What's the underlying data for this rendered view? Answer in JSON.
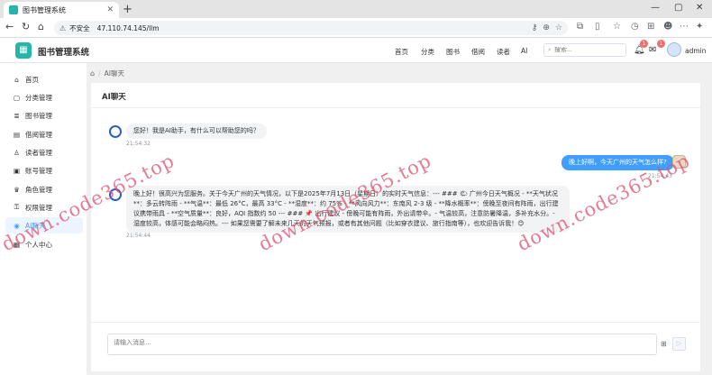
{
  "browser": {
    "tab_title": "图书管理系统",
    "tab_close": "✕",
    "new_tab": "+",
    "window_controls": [
      "—",
      "▢",
      "✕"
    ],
    "insecure_label": "不安全",
    "url": "47.110.74.145/llm"
  },
  "header": {
    "app_title": "图书管理系统",
    "nav": [
      "首页",
      "分类",
      "图书",
      "借阅",
      "读者",
      "AI"
    ],
    "search_placeholder": "搜索...",
    "notification_badge": "1",
    "message_badge": "1",
    "username": "admin"
  },
  "sidebar": {
    "items": [
      {
        "label": "首页",
        "icon": "home-icon",
        "glyph": "⌂"
      },
      {
        "label": "分类管理",
        "icon": "document-icon",
        "glyph": "▢"
      },
      {
        "label": "图书管理",
        "icon": "list-icon",
        "glyph": "≣"
      },
      {
        "label": "借阅管理",
        "icon": "calendar-icon",
        "glyph": "▤"
      },
      {
        "label": "读者管理",
        "icon": "user-icon",
        "glyph": "♙"
      },
      {
        "label": "账号管理",
        "icon": "id-card-icon",
        "glyph": "▣"
      },
      {
        "label": "角色管理",
        "icon": "role-icon",
        "glyph": "♛"
      },
      {
        "label": "权限管理",
        "icon": "lock-icon",
        "glyph": "⚿"
      },
      {
        "label": "AI聊天",
        "icon": "chat-icon",
        "glyph": "◉"
      },
      {
        "label": "个人中心",
        "icon": "profile-icon",
        "glyph": "▦"
      }
    ],
    "active_index": 8
  },
  "breadcrumb": {
    "home_icon": "⌂",
    "separator": "/",
    "current": "AI聊天"
  },
  "chat": {
    "title": "AI聊天",
    "messages": [
      {
        "role": "ai",
        "text": "您好！我是AI助手，有什么可以帮助您的吗？",
        "time": "21:54:32"
      },
      {
        "role": "user",
        "text": "晚上好啊，今天广州的天气怎么样?",
        "time": "21:54:43"
      },
      {
        "role": "ai",
        "text": "晚上好！很高兴为您服务。关于今天广州的天气情况，以下是2025年7月13日（星期日）的实时天气信息：--- ### 🌤 广州今日天气概况 - **天气状况**：多云转阵雨 - **气温**：最低 26°C，最高 33°C - **湿度**：约 75% - **风向风力**：东南风 2-3 级 - **降水概率**：傍晚至夜间有阵雨，出行建议携带雨具 - **空气质量**：良好，AQI 指数约 50 --- ### 📌 出行建议 - 傍晚可能有阵雨，外出请带伞。- 气温较高，注意防暑降温，多补充水分。- 湿度较高，体感可能会略闷热。--- 如果您需要了解未来几天的天气预报，或者有其他问题（比如穿衣建议、旅行指南等），也欢迎告诉我！😊",
        "time": "21:54:44"
      }
    ],
    "input_placeholder": "请输入消息...",
    "attach_glyph": "⊞",
    "send_glyph": "▷"
  },
  "watermark": "down.code365.top"
}
